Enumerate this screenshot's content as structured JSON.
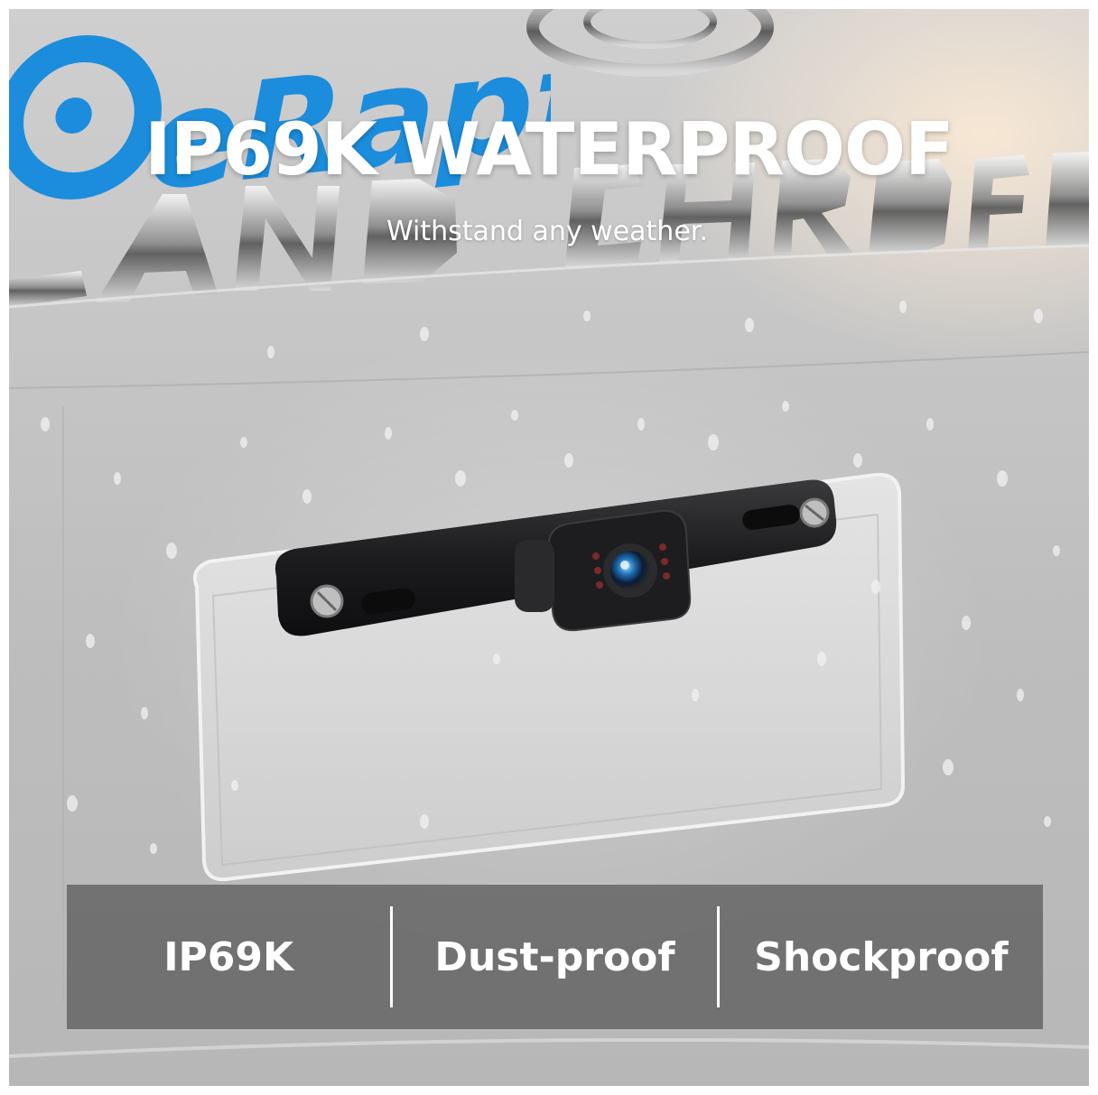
{
  "headline": "IP69K WATERPROOF",
  "subheadline": "Withstand any weather.",
  "brand": {
    "name": "eRapta",
    "color": "#1c8ddc"
  },
  "features": [
    {
      "label": "IP69K"
    },
    {
      "label": "Dust-proof"
    },
    {
      "label": "Shockproof"
    }
  ],
  "colors": {
    "text": "#ffffff",
    "feature_bar": "#464646",
    "camera": "#1e1e20",
    "car_body": "#c4c4c4"
  },
  "icons": [
    "camera-icon",
    "brand-logo-icon"
  ]
}
